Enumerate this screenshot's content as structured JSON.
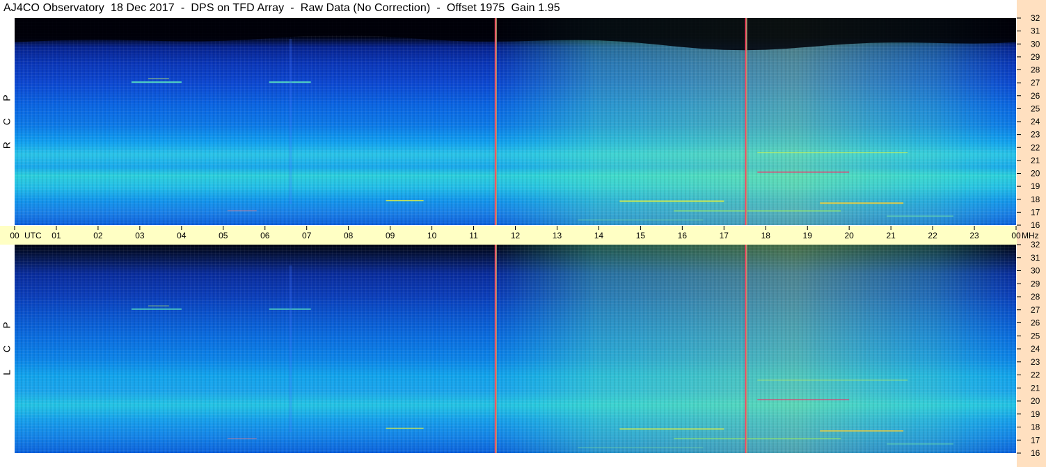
{
  "title": "AJ4CO Observatory  18 Dec 2017  -  DPS on TFD Array  -  Raw Data (No Correction)  -  Offset 1975  Gain 1.95",
  "chart_data": {
    "type": "heatmap",
    "panels": [
      {
        "polarization_letters": [
          "R",
          "C",
          "P"
        ]
      },
      {
        "polarization_letters": [
          "L",
          "C",
          "P"
        ]
      }
    ],
    "time_axis": {
      "range_utc_hours": [
        0,
        24
      ],
      "tick_labels": [
        "00",
        "01",
        "02",
        "03",
        "04",
        "05",
        "06",
        "07",
        "08",
        "09",
        "10",
        "11",
        "12",
        "13",
        "14",
        "15",
        "16",
        "17",
        "18",
        "19",
        "20",
        "21",
        "22",
        "23",
        "00"
      ],
      "start_unit": "UTC",
      "end_unit": "MHz"
    },
    "frequency_axis": {
      "range_mhz": [
        16,
        32
      ],
      "tick_labels": [
        "16",
        "17",
        "18",
        "19",
        "20",
        "21",
        "22",
        "23",
        "24",
        "25",
        "26",
        "27",
        "28",
        "29",
        "30",
        "31",
        "32"
      ]
    },
    "marker_lines_utc": [
      11.53,
      17.53
    ],
    "colors": {
      "axis_band": "#ffffc4",
      "right_margin": "#ffe0c0",
      "marker": "#ff4060",
      "palette": [
        "#000008",
        "#001090",
        "#0050e0",
        "#00a8f0",
        "#40e0c0",
        "#e0f040",
        "#ff2020"
      ]
    }
  }
}
